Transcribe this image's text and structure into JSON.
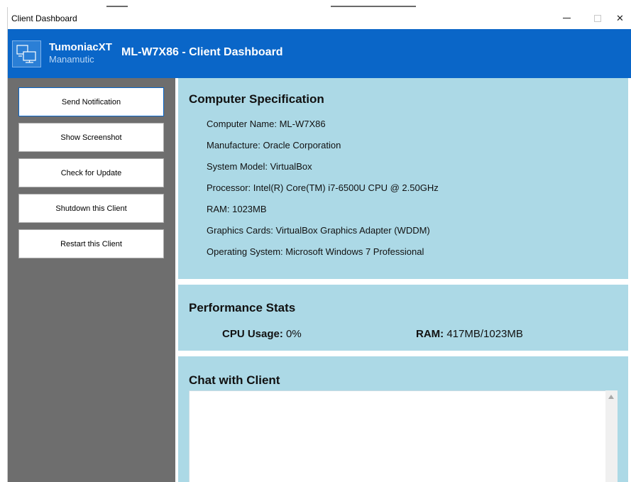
{
  "window": {
    "title": "Client Dashboard",
    "controls": {
      "minimize_icon": "minimize-icon",
      "maximize_icon": "maximize-icon",
      "close_symbol": "✕"
    }
  },
  "header": {
    "brand_name": "TumoniacXT",
    "brand_sub": "Manamutic",
    "title": "ML-W7X86 - Client Dashboard",
    "logo_icon": "computer-network-icon",
    "color": "#0a66c8"
  },
  "sidebar": {
    "buttons": [
      {
        "label": "Send Notification"
      },
      {
        "label": "Show Screenshot"
      },
      {
        "label": "Check for Update"
      },
      {
        "label": "Shutdown this Client"
      },
      {
        "label": "Restart this Client"
      }
    ]
  },
  "spec": {
    "title": "Computer Specification",
    "lines": [
      "Computer Name: ML-W7X86",
      "Manufacture: Oracle Corporation",
      "System Model: VirtualBox",
      "Processor: Intel(R) Core(TM) i7-6500U CPU @ 2.50GHz",
      "RAM: 1023MB",
      "Graphics Cards: VirtualBox Graphics Adapter (WDDM)",
      "Operating System: Microsoft Windows 7 Professional"
    ]
  },
  "performance": {
    "title": "Performance Stats",
    "cpu_label": "CPU Usage:",
    "cpu_value": "0%",
    "ram_label": "RAM:",
    "ram_value": "417MB/1023MB"
  },
  "chat": {
    "title": "Chat with Client",
    "content": ""
  }
}
